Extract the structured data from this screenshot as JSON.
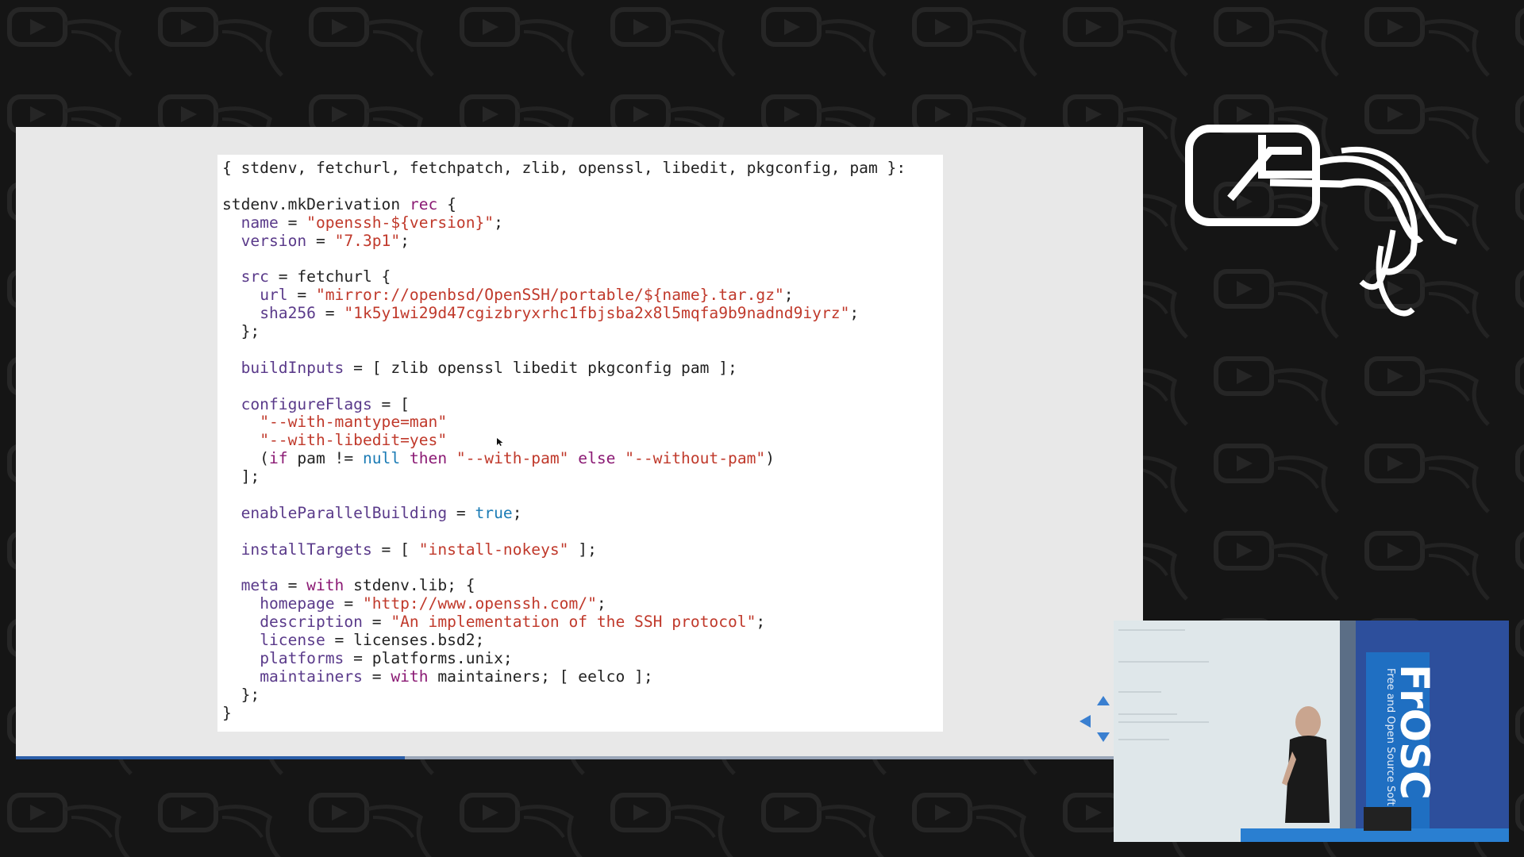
{
  "stage": {
    "logo_icon": "nix-snowflake-tentacle-logo",
    "background_pattern_icon": "video-logo-pattern",
    "colors": {
      "background": "#151515",
      "slide_background": "#e8e8e8",
      "code_background": "#ffffff",
      "progress": "#2b5ea8",
      "keyword": "#8b1a74",
      "attribute": "#5a3a8a",
      "string": "#c0392b",
      "literal": "#1a7bb5"
    }
  },
  "slide": {
    "progress_fraction": 0.345,
    "code_lines": [
      [
        {
          "t": "{ stdenv, fetchurl, fetchpatch, zlib, openssl, libedit, pkgconfig, pam }:",
          "c": "plain"
        }
      ],
      [
        {
          "t": "",
          "c": "plain"
        }
      ],
      [
        {
          "t": "stdenv.mkDerivation ",
          "c": "plain"
        },
        {
          "t": "rec",
          "c": "kw"
        },
        {
          "t": " {",
          "c": "plain"
        }
      ],
      [
        {
          "t": "  ",
          "c": "plain"
        },
        {
          "t": "name",
          "c": "attr"
        },
        {
          "t": " = ",
          "c": "plain"
        },
        {
          "t": "\"openssh-${version}\"",
          "c": "str"
        },
        {
          "t": ";",
          "c": "plain"
        }
      ],
      [
        {
          "t": "  ",
          "c": "plain"
        },
        {
          "t": "version",
          "c": "attr"
        },
        {
          "t": " = ",
          "c": "plain"
        },
        {
          "t": "\"7.3p1\"",
          "c": "str"
        },
        {
          "t": ";",
          "c": "plain"
        }
      ],
      [
        {
          "t": "",
          "c": "plain"
        }
      ],
      [
        {
          "t": "  ",
          "c": "plain"
        },
        {
          "t": "src",
          "c": "attr"
        },
        {
          "t": " = fetchurl {",
          "c": "plain"
        }
      ],
      [
        {
          "t": "    ",
          "c": "plain"
        },
        {
          "t": "url",
          "c": "attr"
        },
        {
          "t": " = ",
          "c": "plain"
        },
        {
          "t": "\"mirror://openbsd/OpenSSH/portable/${name}.tar.gz\"",
          "c": "str"
        },
        {
          "t": ";",
          "c": "plain"
        }
      ],
      [
        {
          "t": "    ",
          "c": "plain"
        },
        {
          "t": "sha256",
          "c": "attr"
        },
        {
          "t": " = ",
          "c": "plain"
        },
        {
          "t": "\"1k5y1wi29d47cgizbryxrhc1fbjsba2x8l5mqfa9b9nadnd9iyrz\"",
          "c": "str"
        },
        {
          "t": ";",
          "c": "plain"
        }
      ],
      [
        {
          "t": "  };",
          "c": "plain"
        }
      ],
      [
        {
          "t": "",
          "c": "plain"
        }
      ],
      [
        {
          "t": "  ",
          "c": "plain"
        },
        {
          "t": "buildInputs",
          "c": "attr"
        },
        {
          "t": " = [ zlib openssl libedit pkgconfig pam ];",
          "c": "plain"
        }
      ],
      [
        {
          "t": "",
          "c": "plain"
        }
      ],
      [
        {
          "t": "  ",
          "c": "plain"
        },
        {
          "t": "configureFlags",
          "c": "attr"
        },
        {
          "t": " = [",
          "c": "plain"
        }
      ],
      [
        {
          "t": "    ",
          "c": "plain"
        },
        {
          "t": "\"--with-mantype=man\"",
          "c": "str"
        }
      ],
      [
        {
          "t": "    ",
          "c": "plain"
        },
        {
          "t": "\"--with-libedit=yes\"",
          "c": "str"
        }
      ],
      [
        {
          "t": "    (",
          "c": "plain"
        },
        {
          "t": "if",
          "c": "kw"
        },
        {
          "t": " pam != ",
          "c": "plain"
        },
        {
          "t": "null",
          "c": "lit"
        },
        {
          "t": " ",
          "c": "plain"
        },
        {
          "t": "then",
          "c": "kw"
        },
        {
          "t": " ",
          "c": "plain"
        },
        {
          "t": "\"--with-pam\"",
          "c": "str"
        },
        {
          "t": " ",
          "c": "plain"
        },
        {
          "t": "else",
          "c": "kw"
        },
        {
          "t": " ",
          "c": "plain"
        },
        {
          "t": "\"--without-pam\"",
          "c": "str"
        },
        {
          "t": ")",
          "c": "plain"
        }
      ],
      [
        {
          "t": "  ];",
          "c": "plain"
        }
      ],
      [
        {
          "t": "",
          "c": "plain"
        }
      ],
      [
        {
          "t": "  ",
          "c": "plain"
        },
        {
          "t": "enableParallelBuilding",
          "c": "attr"
        },
        {
          "t": " = ",
          "c": "plain"
        },
        {
          "t": "true",
          "c": "lit"
        },
        {
          "t": ";",
          "c": "plain"
        }
      ],
      [
        {
          "t": "",
          "c": "plain"
        }
      ],
      [
        {
          "t": "  ",
          "c": "plain"
        },
        {
          "t": "installTargets",
          "c": "attr"
        },
        {
          "t": " = [ ",
          "c": "plain"
        },
        {
          "t": "\"install-nokeys\"",
          "c": "str"
        },
        {
          "t": " ];",
          "c": "plain"
        }
      ],
      [
        {
          "t": "",
          "c": "plain"
        }
      ],
      [
        {
          "t": "  ",
          "c": "plain"
        },
        {
          "t": "meta",
          "c": "attr"
        },
        {
          "t": " = ",
          "c": "plain"
        },
        {
          "t": "with",
          "c": "kw"
        },
        {
          "t": " stdenv.lib; {",
          "c": "plain"
        }
      ],
      [
        {
          "t": "    ",
          "c": "plain"
        },
        {
          "t": "homepage",
          "c": "attr"
        },
        {
          "t": " = ",
          "c": "plain"
        },
        {
          "t": "\"http://www.openssh.com/\"",
          "c": "str"
        },
        {
          "t": ";",
          "c": "plain"
        }
      ],
      [
        {
          "t": "    ",
          "c": "plain"
        },
        {
          "t": "description",
          "c": "attr"
        },
        {
          "t": " = ",
          "c": "plain"
        },
        {
          "t": "\"An implementation of the SSH protocol\"",
          "c": "str"
        },
        {
          "t": ";",
          "c": "plain"
        }
      ],
      [
        {
          "t": "    ",
          "c": "plain"
        },
        {
          "t": "license",
          "c": "attr"
        },
        {
          "t": " = licenses.bsd2;",
          "c": "plain"
        }
      ],
      [
        {
          "t": "    ",
          "c": "plain"
        },
        {
          "t": "platforms",
          "c": "attr"
        },
        {
          "t": " = platforms.unix;",
          "c": "plain"
        }
      ],
      [
        {
          "t": "    ",
          "c": "plain"
        },
        {
          "t": "maintainers",
          "c": "attr"
        },
        {
          "t": " = ",
          "c": "plain"
        },
        {
          "t": "with",
          "c": "kw"
        },
        {
          "t": " maintainers; [ eelco ];",
          "c": "plain"
        }
      ],
      [
        {
          "t": "  };",
          "c": "plain"
        }
      ],
      [
        {
          "t": "}",
          "c": "plain"
        }
      ]
    ]
  },
  "navigation": {
    "icons": [
      "nav-up-arrow-icon",
      "nav-left-arrow-icon",
      "nav-down-arrow-icon"
    ],
    "arrow_color": "#3a7fd0"
  },
  "speaker_video": {
    "icon": "speaker-camera-feed",
    "banner_text": "FrOSC",
    "banner_subtext": "Free and Open Source Soft",
    "banner_color": "#1f6fc2"
  }
}
